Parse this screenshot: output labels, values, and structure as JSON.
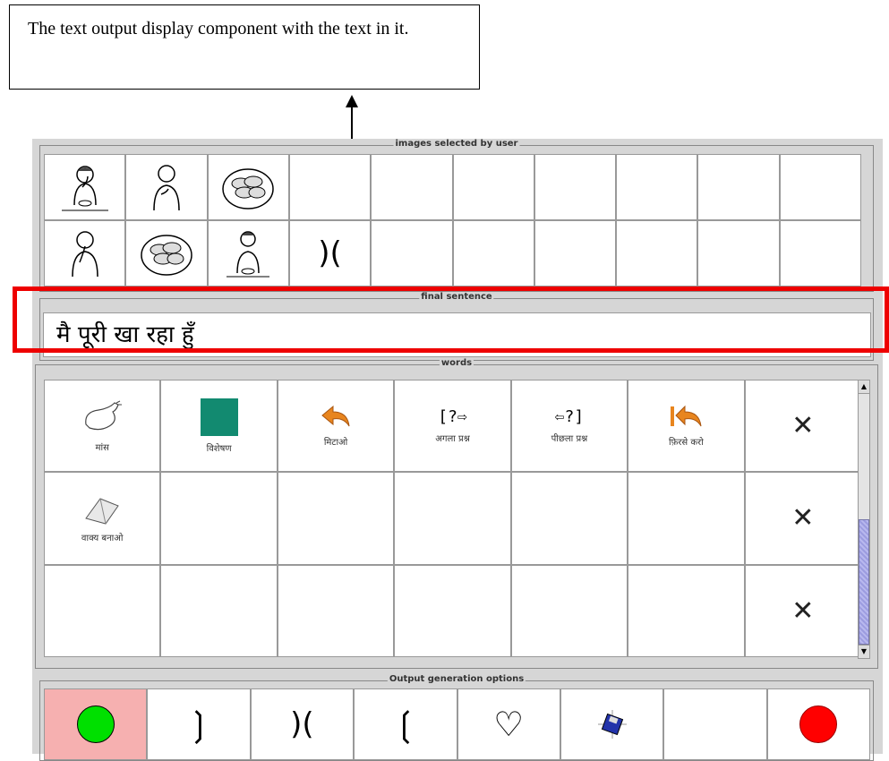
{
  "callout": {
    "text": "The text output display component with the text in it."
  },
  "panels": {
    "images_legend": "images selected by user",
    "sentence_legend": "final sentence",
    "words_legend": "words",
    "output_legend": "Output generation options"
  },
  "sentence": {
    "text": "मै पूरी खा रहा हुँ"
  },
  "words": {
    "row1": [
      {
        "label": "मांस",
        "icon": "meat-icon"
      },
      {
        "label": "विशेषण",
        "icon": "green-square-icon"
      },
      {
        "label": "मिटाओ",
        "icon": "undo-arrow-icon"
      },
      {
        "label": "अगला प्रश्न",
        "icon": "next-question-icon"
      },
      {
        "label": "पीछला प्रश्न",
        "icon": "previous-question-icon"
      },
      {
        "label": "फ़िरसे करो",
        "icon": "restart-icon"
      }
    ],
    "row2_label": "वाक्य बनाओ",
    "close_glyph": "✕"
  },
  "output": {
    "symbols": [
      "❳",
      ")(",
      "❲",
      "♡"
    ]
  },
  "colors": {
    "highlight": "#e00000",
    "active_cell": "#f6b0b0",
    "green": "#00e000",
    "red": "#ff0000",
    "teal": "#128a70",
    "orange": "#e8851e"
  }
}
